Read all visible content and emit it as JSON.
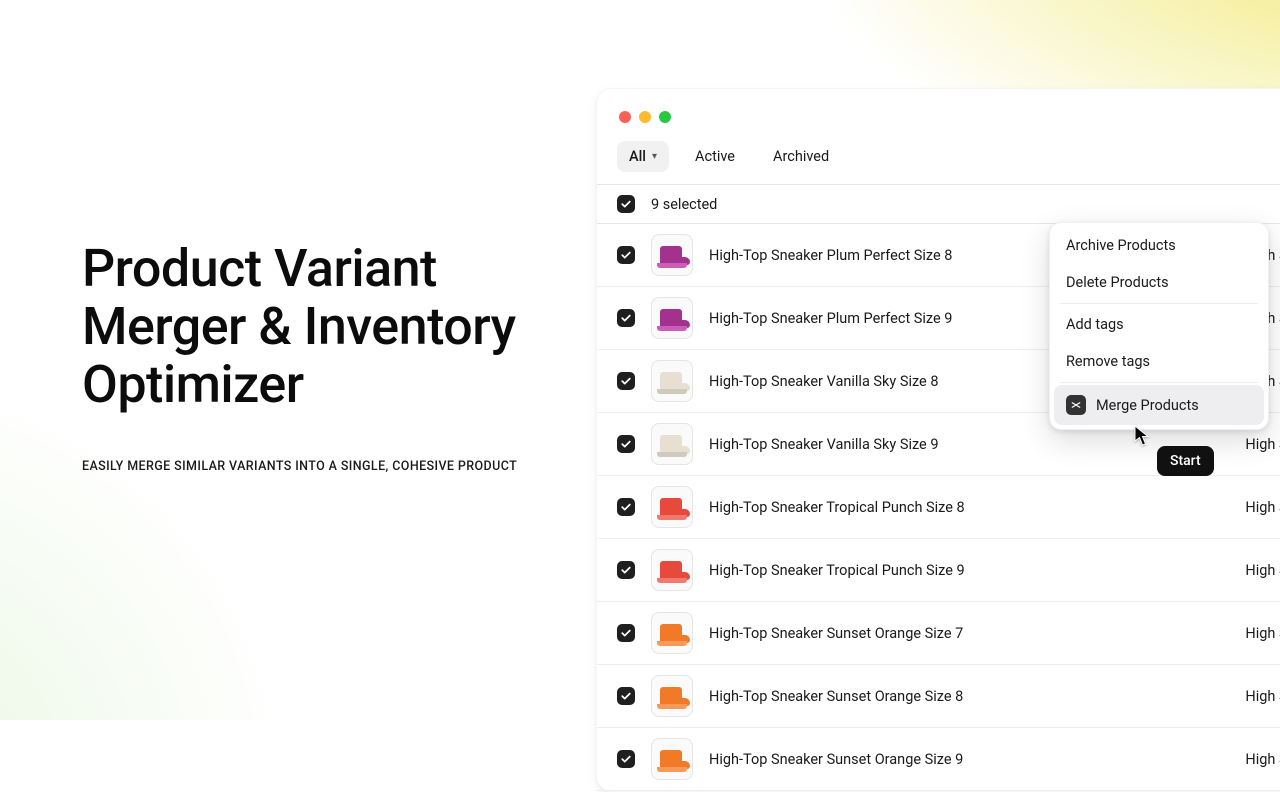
{
  "hero": {
    "title": "Product Variant Merger & Inventory Optimizer",
    "subtitle": "EASILY MERGE SIMILAR VARIANTS INTO A SINGLE, COHESIVE PRODUCT"
  },
  "tabs": {
    "all": "All",
    "active": "Active",
    "archived": "Archived"
  },
  "selection": {
    "count_text": "9 selected"
  },
  "products": [
    {
      "name": "High-Top Sneaker Plum Perfect Size 8",
      "type": "High Sneaker",
      "color": "plum"
    },
    {
      "name": "High-Top Sneaker Plum Perfect Size 9",
      "type": "High Sneaker",
      "color": "plum"
    },
    {
      "name": "High-Top Sneaker Vanilla Sky Size 8",
      "type": "High Sneaker",
      "color": "vanilla"
    },
    {
      "name": "High-Top Sneaker Vanilla Sky Size 9",
      "type": "High Sneaker",
      "color": "vanilla"
    },
    {
      "name": "High-Top Sneaker Tropical Punch Size 8",
      "type": "High Sneaker",
      "color": "tropical"
    },
    {
      "name": "High-Top Sneaker Tropical Punch Size 9",
      "type": "High Sneaker",
      "color": "tropical"
    },
    {
      "name": "High-Top Sneaker Sunset Orange Size 7",
      "type": "High Sneaker",
      "color": "orange"
    },
    {
      "name": "High-Top Sneaker Sunset Orange Size 8",
      "type": "High Sneaker",
      "color": "orange"
    },
    {
      "name": "High-Top Sneaker Sunset Orange Size 9",
      "type": "High Sneaker",
      "color": "orange"
    }
  ],
  "menu": {
    "archive": "Archive Products",
    "delete": "Delete Products",
    "add_tags": "Add tags",
    "remove_tags": "Remove tags",
    "merge": "Merge Products"
  },
  "tooltip": {
    "label": "Start"
  }
}
